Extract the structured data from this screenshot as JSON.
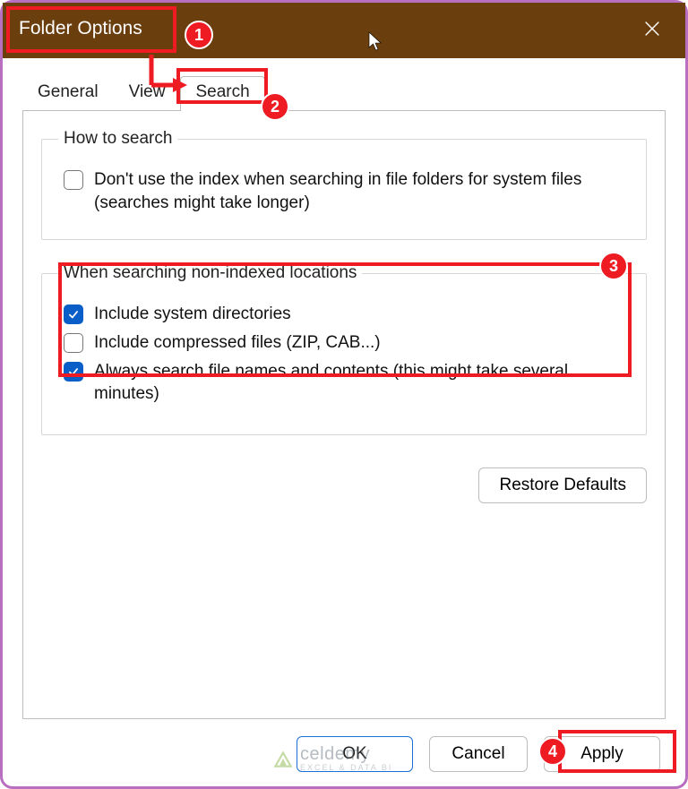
{
  "titlebar": {
    "title": "Folder Options"
  },
  "tabs": {
    "general": "General",
    "view": "View",
    "search": "Search"
  },
  "group1": {
    "legend": "How to search",
    "opt1": "Don't use the index when searching in file folders for system files (searches might take longer)"
  },
  "group2": {
    "legend": "When searching non-indexed locations",
    "opt1": "Include system directories",
    "opt2": "Include compressed files (ZIP, CAB...)",
    "opt3": "Always search file names and contents (this might take several minutes)"
  },
  "buttons": {
    "restore": "Restore Defaults",
    "ok": "OK",
    "cancel": "Cancel",
    "apply": "Apply"
  },
  "watermark": {
    "brand": "celdemy",
    "tagline": "EXCEL & DATA BI"
  },
  "annotations": {
    "b1": "1",
    "b2": "2",
    "b3": "3",
    "b4": "4"
  }
}
